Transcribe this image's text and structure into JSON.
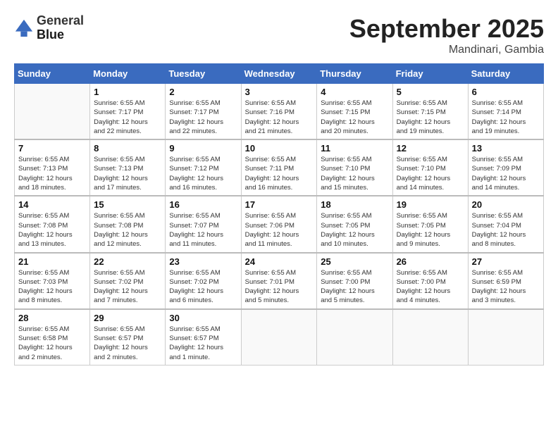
{
  "header": {
    "logo_line1": "General",
    "logo_line2": "Blue",
    "month_title": "September 2025",
    "location": "Mandinari, Gambia"
  },
  "weekdays": [
    "Sunday",
    "Monday",
    "Tuesday",
    "Wednesday",
    "Thursday",
    "Friday",
    "Saturday"
  ],
  "weeks": [
    [
      {
        "day": "",
        "info": ""
      },
      {
        "day": "1",
        "info": "Sunrise: 6:55 AM\nSunset: 7:17 PM\nDaylight: 12 hours\nand 22 minutes."
      },
      {
        "day": "2",
        "info": "Sunrise: 6:55 AM\nSunset: 7:17 PM\nDaylight: 12 hours\nand 22 minutes."
      },
      {
        "day": "3",
        "info": "Sunrise: 6:55 AM\nSunset: 7:16 PM\nDaylight: 12 hours\nand 21 minutes."
      },
      {
        "day": "4",
        "info": "Sunrise: 6:55 AM\nSunset: 7:15 PM\nDaylight: 12 hours\nand 20 minutes."
      },
      {
        "day": "5",
        "info": "Sunrise: 6:55 AM\nSunset: 7:15 PM\nDaylight: 12 hours\nand 19 minutes."
      },
      {
        "day": "6",
        "info": "Sunrise: 6:55 AM\nSunset: 7:14 PM\nDaylight: 12 hours\nand 19 minutes."
      }
    ],
    [
      {
        "day": "7",
        "info": "Sunrise: 6:55 AM\nSunset: 7:13 PM\nDaylight: 12 hours\nand 18 minutes."
      },
      {
        "day": "8",
        "info": "Sunrise: 6:55 AM\nSunset: 7:13 PM\nDaylight: 12 hours\nand 17 minutes."
      },
      {
        "day": "9",
        "info": "Sunrise: 6:55 AM\nSunset: 7:12 PM\nDaylight: 12 hours\nand 16 minutes."
      },
      {
        "day": "10",
        "info": "Sunrise: 6:55 AM\nSunset: 7:11 PM\nDaylight: 12 hours\nand 16 minutes."
      },
      {
        "day": "11",
        "info": "Sunrise: 6:55 AM\nSunset: 7:10 PM\nDaylight: 12 hours\nand 15 minutes."
      },
      {
        "day": "12",
        "info": "Sunrise: 6:55 AM\nSunset: 7:10 PM\nDaylight: 12 hours\nand 14 minutes."
      },
      {
        "day": "13",
        "info": "Sunrise: 6:55 AM\nSunset: 7:09 PM\nDaylight: 12 hours\nand 14 minutes."
      }
    ],
    [
      {
        "day": "14",
        "info": "Sunrise: 6:55 AM\nSunset: 7:08 PM\nDaylight: 12 hours\nand 13 minutes."
      },
      {
        "day": "15",
        "info": "Sunrise: 6:55 AM\nSunset: 7:08 PM\nDaylight: 12 hours\nand 12 minutes."
      },
      {
        "day": "16",
        "info": "Sunrise: 6:55 AM\nSunset: 7:07 PM\nDaylight: 12 hours\nand 11 minutes."
      },
      {
        "day": "17",
        "info": "Sunrise: 6:55 AM\nSunset: 7:06 PM\nDaylight: 12 hours\nand 11 minutes."
      },
      {
        "day": "18",
        "info": "Sunrise: 6:55 AM\nSunset: 7:05 PM\nDaylight: 12 hours\nand 10 minutes."
      },
      {
        "day": "19",
        "info": "Sunrise: 6:55 AM\nSunset: 7:05 PM\nDaylight: 12 hours\nand 9 minutes."
      },
      {
        "day": "20",
        "info": "Sunrise: 6:55 AM\nSunset: 7:04 PM\nDaylight: 12 hours\nand 8 minutes."
      }
    ],
    [
      {
        "day": "21",
        "info": "Sunrise: 6:55 AM\nSunset: 7:03 PM\nDaylight: 12 hours\nand 8 minutes."
      },
      {
        "day": "22",
        "info": "Sunrise: 6:55 AM\nSunset: 7:02 PM\nDaylight: 12 hours\nand 7 minutes."
      },
      {
        "day": "23",
        "info": "Sunrise: 6:55 AM\nSunset: 7:02 PM\nDaylight: 12 hours\nand 6 minutes."
      },
      {
        "day": "24",
        "info": "Sunrise: 6:55 AM\nSunset: 7:01 PM\nDaylight: 12 hours\nand 5 minutes."
      },
      {
        "day": "25",
        "info": "Sunrise: 6:55 AM\nSunset: 7:00 PM\nDaylight: 12 hours\nand 5 minutes."
      },
      {
        "day": "26",
        "info": "Sunrise: 6:55 AM\nSunset: 7:00 PM\nDaylight: 12 hours\nand 4 minutes."
      },
      {
        "day": "27",
        "info": "Sunrise: 6:55 AM\nSunset: 6:59 PM\nDaylight: 12 hours\nand 3 minutes."
      }
    ],
    [
      {
        "day": "28",
        "info": "Sunrise: 6:55 AM\nSunset: 6:58 PM\nDaylight: 12 hours\nand 2 minutes."
      },
      {
        "day": "29",
        "info": "Sunrise: 6:55 AM\nSunset: 6:57 PM\nDaylight: 12 hours\nand 2 minutes."
      },
      {
        "day": "30",
        "info": "Sunrise: 6:55 AM\nSunset: 6:57 PM\nDaylight: 12 hours\nand 1 minute."
      },
      {
        "day": "",
        "info": ""
      },
      {
        "day": "",
        "info": ""
      },
      {
        "day": "",
        "info": ""
      },
      {
        "day": "",
        "info": ""
      }
    ]
  ]
}
